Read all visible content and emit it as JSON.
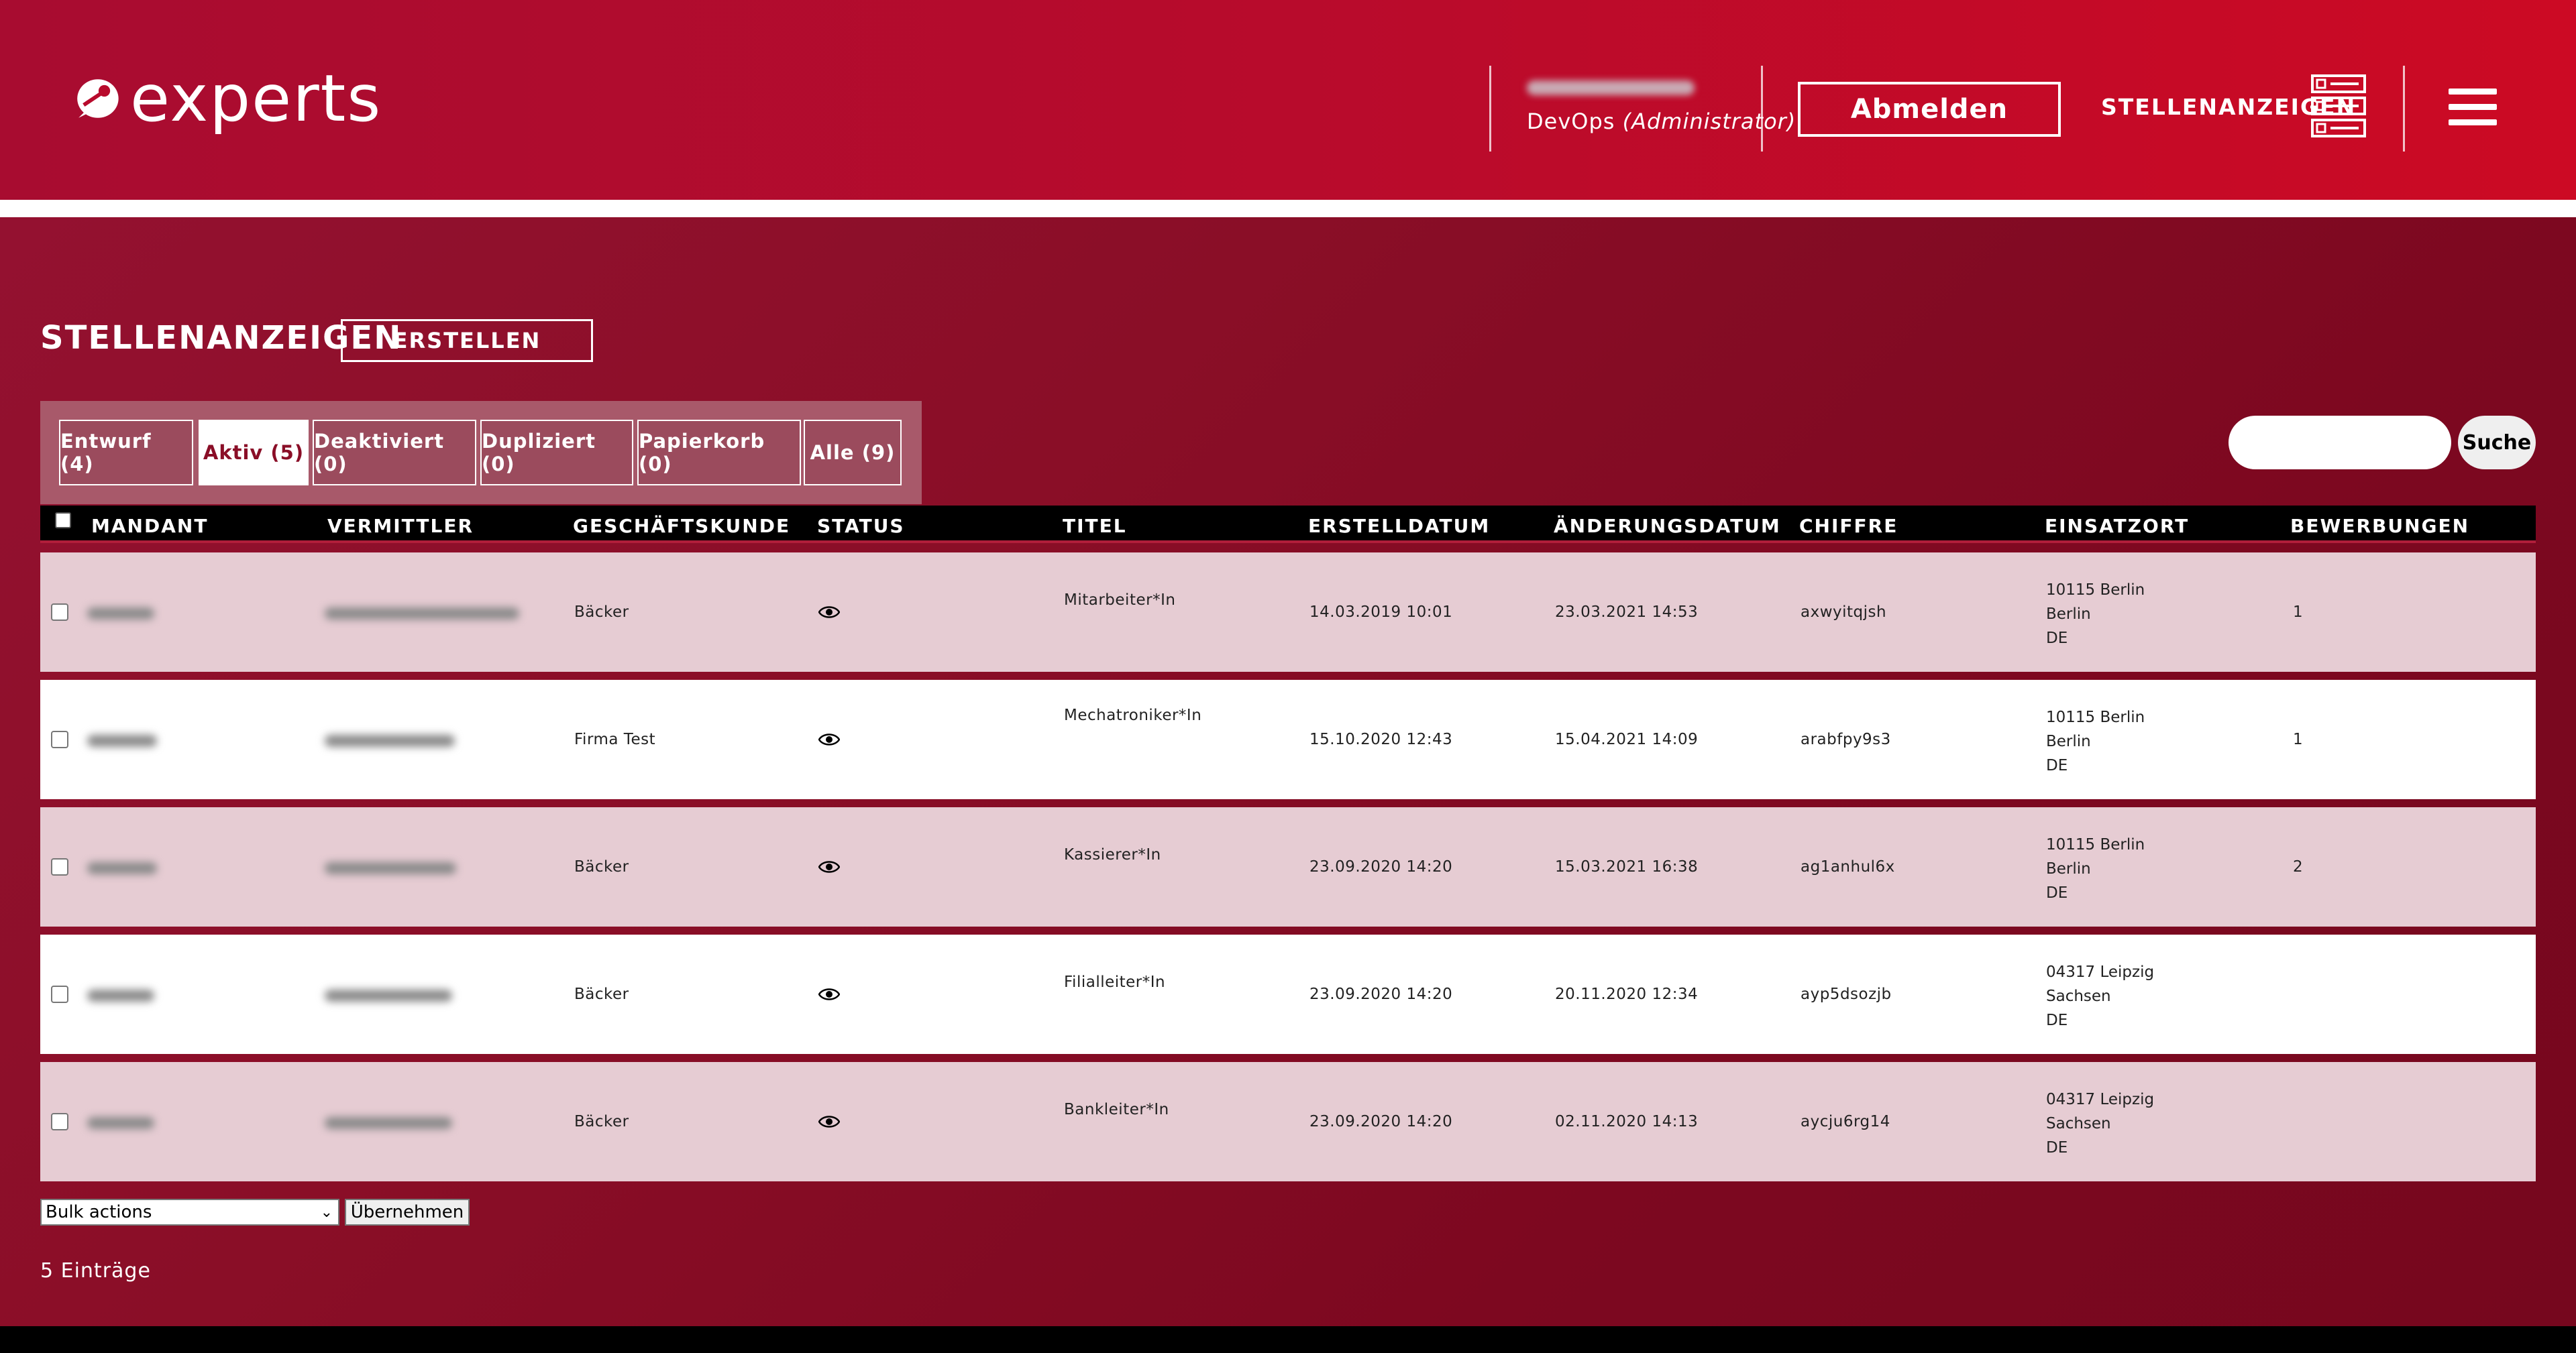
{
  "header": {
    "logo_text": "experts",
    "user_role_prefix": "DevOps",
    "user_role_suffix": "(Administrator)",
    "logout_label": "Abmelden",
    "nav_link": "STELLENANZEIGEN"
  },
  "page": {
    "title": "STELLENANZEIGEN",
    "create_label": "ERSTELLEN"
  },
  "tabs": [
    {
      "label": "Entwurf (4)",
      "active": false
    },
    {
      "label": "Aktiv (5)",
      "active": true
    },
    {
      "label": "Deaktiviert (0)",
      "active": false
    },
    {
      "label": "Dupliziert (0)",
      "active": false
    },
    {
      "label": "Papierkorb (0)",
      "active": false
    },
    {
      "label": "Alle (9)",
      "active": false
    }
  ],
  "search": {
    "value": "",
    "button_label": "Suche"
  },
  "table": {
    "columns": [
      "MANDANT",
      "VERMITTLER",
      "GESCHÄFTSKUNDE",
      "STATUS",
      "TITEL",
      "ERSTELLDATUM",
      "ÄNDERUNGSDATUM",
      "CHIFFRE",
      "EINSATZORT",
      "BEWERBUNGEN"
    ],
    "rows": [
      {
        "kunde": "Bäcker",
        "titel": "Mitarbeiter*In",
        "erstellt": "14.03.2019 10:01",
        "geaendert": "23.03.2021 14:53",
        "chiffre": "axwyitqjsh",
        "ort1": "10115 Berlin",
        "ort2": "Berlin",
        "ort3": "DE",
        "bewerbungen": "1"
      },
      {
        "kunde": "Firma Test",
        "titel": "Mechatroniker*In",
        "erstellt": "15.10.2020 12:43",
        "geaendert": "15.04.2021 14:09",
        "chiffre": "arabfpy9s3",
        "ort1": "10115 Berlin",
        "ort2": "Berlin",
        "ort3": "DE",
        "bewerbungen": "1"
      },
      {
        "kunde": "Bäcker",
        "titel": "Kassierer*In",
        "erstellt": "23.09.2020 14:20",
        "geaendert": "15.03.2021 16:38",
        "chiffre": "ag1anhul6x",
        "ort1": "10115 Berlin",
        "ort2": "Berlin",
        "ort3": "DE",
        "bewerbungen": "2"
      },
      {
        "kunde": "Bäcker",
        "titel": "Filialleiter*In",
        "erstellt": "23.09.2020 14:20",
        "geaendert": "20.11.2020 12:34",
        "chiffre": "ayp5dsozjb",
        "ort1": "04317 Leipzig",
        "ort2": "Sachsen",
        "ort3": "DE",
        "bewerbungen": ""
      },
      {
        "kunde": "Bäcker",
        "titel": "Bankleiter*In",
        "erstellt": "23.09.2020 14:20",
        "geaendert": "02.11.2020 14:13",
        "chiffre": "aycju6rg14",
        "ort1": "04317 Leipzig",
        "ort2": "Sachsen",
        "ort3": "DE",
        "bewerbungen": ""
      }
    ]
  },
  "footer": {
    "bulk_label": "Bulk actions",
    "apply_label": "Übernehmen",
    "entries": "5 Einträge"
  },
  "icons": {
    "logo": "logo-icon",
    "nav": "list-checks-icon",
    "menu": "hamburger-icon",
    "status": "eye-icon"
  },
  "colors": {
    "header": "#b80b2c",
    "main_bg": "#8a0e27",
    "row_pink": "#e6ccd3",
    "tab_panel": "#a8596a"
  }
}
